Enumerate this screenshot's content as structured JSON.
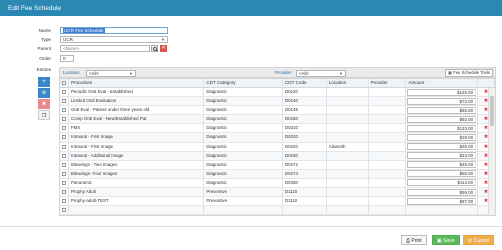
{
  "window": {
    "title": "Edit Fee Schedule"
  },
  "form": {
    "name_label": "Name",
    "name_value": "UCR Fee Schedule",
    "type_label": "Type",
    "type_value": "UCR",
    "parent_label": "Parent",
    "parent_value": "<None>",
    "order_label": "Order",
    "order_value": "0",
    "entries_label": "Entries"
  },
  "toolbar": {
    "location_label": "Location",
    "location_value": "<All>",
    "provider_label": "Provider",
    "provider_value": "<All>",
    "tools_label": "Fee Schedule Tools"
  },
  "grid": {
    "headers": [
      "Procedure",
      "CDT Category",
      "CDT Code",
      "Location",
      "Provider",
      "Amount"
    ],
    "rows": [
      {
        "procedure": "Periodic Oral Eval - Established",
        "category": "Diagnostic",
        "code": "D0120",
        "location": "",
        "provider": "",
        "amount": "$125.00"
      },
      {
        "procedure": "Limited Oral Evaluation",
        "category": "Diagnostic",
        "code": "D0140",
        "location": "",
        "provider": "",
        "amount": "$73.00"
      },
      {
        "procedure": "Oral Eval - Patient under three years old",
        "category": "Diagnostic",
        "code": "D0145",
        "location": "",
        "provider": "",
        "amount": "$55.00"
      },
      {
        "procedure": "Comp Oral Eval - New/Established Pat",
        "category": "Diagnostic",
        "code": "D0150",
        "location": "",
        "provider": "",
        "amount": "$92.00"
      },
      {
        "procedure": "FMX",
        "category": "Diagnostic",
        "code": "D0210",
        "location": "",
        "provider": "",
        "amount": "$133.00"
      },
      {
        "procedure": "Intraoral - First Image",
        "category": "Diagnostic",
        "code": "D0220",
        "location": "",
        "provider": "",
        "amount": "$29.00"
      },
      {
        "procedure": "Intraoral - First Image",
        "category": "Diagnostic",
        "code": "D0220",
        "location": "Alsworth",
        "provider": "",
        "amount": "$28.00"
      },
      {
        "procedure": "Intraoral - Additional Image",
        "category": "Diagnostic",
        "code": "D0230",
        "location": "",
        "provider": "",
        "amount": "$23.00"
      },
      {
        "procedure": "Bitewings - Two Images",
        "category": "Diagnostic",
        "code": "D0272",
        "location": "",
        "provider": "",
        "amount": "$45.00"
      },
      {
        "procedure": "Bitewings- Four Images",
        "category": "Diagnostic",
        "code": "D0274",
        "location": "",
        "provider": "",
        "amount": "$65.00"
      },
      {
        "procedure": "Panoramic",
        "category": "Diagnostic",
        "code": "D0330",
        "location": "",
        "provider": "",
        "amount": "$113.00"
      },
      {
        "procedure": "Prophy Adult",
        "category": "Preventive",
        "code": "D1110",
        "location": "",
        "provider": "",
        "amount": "$99.00"
      },
      {
        "procedure": "Prophy-adult-TEST",
        "category": "Preventive",
        "code": "D1110",
        "location": "",
        "provider": "",
        "amount": "$87.00"
      },
      {
        "procedure": "",
        "category": "",
        "code": "",
        "location": "",
        "provider": "",
        "amount": ""
      }
    ]
  },
  "footer": {
    "print_label": "Print",
    "save_label": "Save",
    "cancel_label": "Cancel"
  },
  "icons": {
    "search": "search-icon",
    "clear": "clear-icon",
    "add": "plus-icon",
    "edit": "pencil-icon",
    "delete": "delete-icon",
    "copy": "copy-icon"
  },
  "colors": {
    "titlebar": "#2b88b3",
    "save": "#5cb85c",
    "cancel": "#f0ad4e",
    "delete": "#e05a5a",
    "add": "#3a87c9"
  }
}
